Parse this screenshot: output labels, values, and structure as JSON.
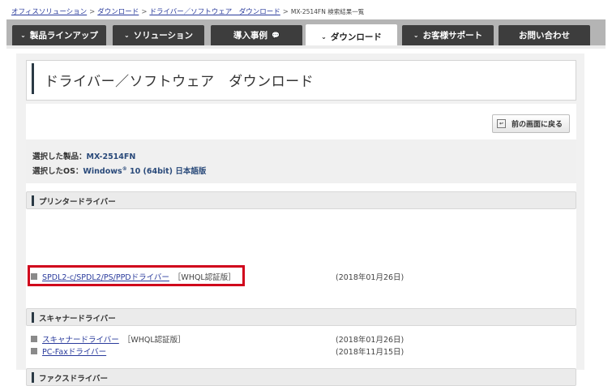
{
  "breadcrumb": {
    "items": [
      "オフィスソリューション",
      "ダウンロード",
      "ドライバー／ソフトウェア　ダウンロード"
    ],
    "separator": ">",
    "current": "MX-2514FN 検索結果一覧"
  },
  "nav": {
    "tabs": [
      {
        "label": "製品ラインアップ",
        "chevron": "⌄"
      },
      {
        "label": "ソリューション",
        "chevron": "⌄"
      },
      {
        "label": "導入事例",
        "icon": "speech-bubble-icon"
      },
      {
        "label": "ダウンロード",
        "chevron": "⌄",
        "active": true
      },
      {
        "label": "お客様サポート",
        "chevron": "⌄"
      },
      {
        "label": "お問い合わせ"
      }
    ]
  },
  "page": {
    "title": "ドライバー／ソフトウェア　ダウンロード",
    "back_button": "前の画面に戻る"
  },
  "selection": {
    "product_label": "選択した製品：",
    "product_value": "MX-2514FN",
    "os_label": "選択したOS：",
    "os_value_pre": "Windows",
    "os_value_sup": "®",
    "os_value_post": " 10 (64bit) 日本語版"
  },
  "sections": [
    {
      "title": "プリンタードライバー",
      "items": [
        {
          "link": "SPDL2-c/SPDL2/PS/PPDドライバー",
          "note": "［WHQL認証版］",
          "date": "(2018年01月26日)"
        }
      ]
    },
    {
      "title": "スキャナードライバー",
      "items": [
        {
          "link": "スキャナードライバー",
          "note": "［WHQL認証版］",
          "date": "(2018年01月26日)"
        }
      ]
    },
    {
      "title": "ファクスドライバー",
      "items": [
        {
          "link": "PC-Faxドライバー",
          "note": "",
          "date": "(2018年11月15日)"
        }
      ]
    }
  ],
  "colors": {
    "nav_tab": "#3d3d3d",
    "nav_bar": "#b4b4b4",
    "link": "#2a3b9c",
    "highlight": "#d0021b",
    "accent_bar": "#2b3a45"
  }
}
